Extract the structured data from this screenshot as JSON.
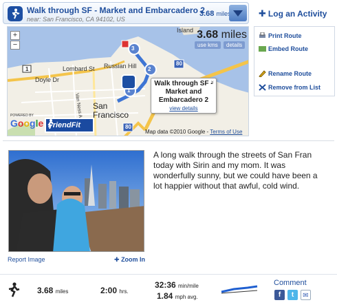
{
  "activity": {
    "title": "Walk through SF - Market and Embarcadero 2",
    "location": "near: San Francisco, CA 94102, US",
    "distance_value": "3.68",
    "distance_unit": "miles"
  },
  "log_activity_label": "Log an Activity",
  "map": {
    "distance_display": "3.68",
    "distance_unit": "miles",
    "use_kms_label": "use kms",
    "details_label": "details",
    "labels": {
      "island": "Island",
      "doyle": "Doyle Dr",
      "lombard": "Lombard St",
      "russian_hill": "Russian Hill",
      "van_ness": "Van Ness Ave",
      "city": "San",
      "city2": "Francisco",
      "hwy_1": "1",
      "hwy_80a": "80",
      "hwy_80b": "80"
    },
    "markers": [
      "1",
      "2",
      "3"
    ],
    "popup_title": "Walk through SF - Market and Embarcadero 2",
    "popup_link": "view details",
    "powered_by": "POWERED BY",
    "google_logo": "Google",
    "friendfit": "FriendFit",
    "map_data": "Map data ©2010 Google -",
    "terms": "Terms of Use"
  },
  "menu": {
    "print_route": "Print Route",
    "embed_route": "Embed Route",
    "rename_route": "Rename Route",
    "remove_from_list": "Remove from List"
  },
  "photo": {
    "report_label": "Report Image",
    "zoom_in_label": "Zoom In"
  },
  "description": "A long walk through the streets of San Fran today with Sirin and my mom. It was wonderfully sunny, but we could have been a lot happier without that awful, cold wind.",
  "stats": {
    "distance": "3.68",
    "distance_unit": "miles",
    "duration": "2:00",
    "duration_unit": "hrs.",
    "pace": "32:36",
    "pace_unit": "min/mile",
    "speed": "1.84",
    "speed_unit": "mph avg.",
    "comment_label": "Comment",
    "social": [
      "f",
      "t",
      "✉"
    ]
  },
  "colors": {
    "accent": "#1f4e9c",
    "water": "#a7c2e8",
    "route": "#1f5fd0"
  }
}
